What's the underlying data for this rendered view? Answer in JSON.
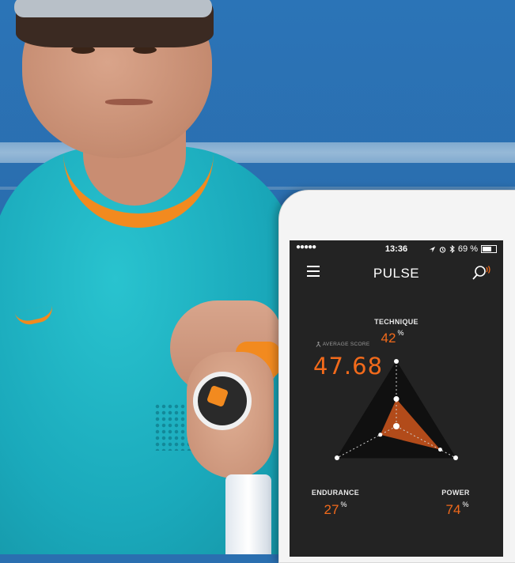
{
  "status_bar": {
    "signal": "●●●●●",
    "time": "13:36",
    "battery_percent": "69 %",
    "battery_level": 0.69
  },
  "app": {
    "title": "PULSE"
  },
  "dashboard": {
    "average_score_label": "AVERAGE SCORE",
    "average_score": "47.68",
    "metrics": {
      "technique": {
        "label": "TECHNIQUE",
        "value": "42",
        "unit": "%"
      },
      "endurance": {
        "label": "ENDURANCE",
        "value": "27",
        "unit": "%"
      },
      "power": {
        "label": "POWER",
        "value": "74",
        "unit": "%"
      }
    }
  },
  "colors": {
    "accent": "#f26a1b",
    "screen_bg": "#232323",
    "radar_fill": "#c4521c"
  },
  "icons": [
    "menu-icon",
    "search-icon",
    "location-arrow-icon",
    "alarm-icon",
    "bluetooth-icon",
    "battery-icon",
    "person-icon"
  ]
}
